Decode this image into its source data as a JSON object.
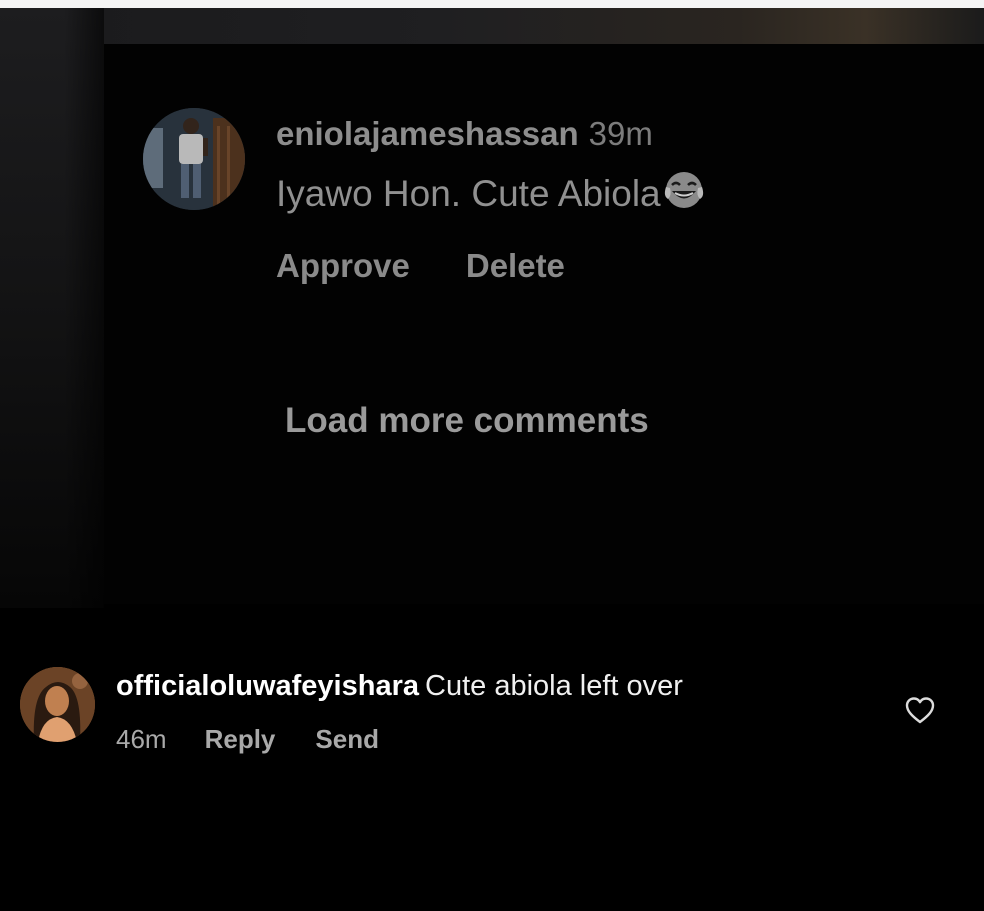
{
  "pending_comment": {
    "username": "eniolajameshassan",
    "time": "39m",
    "text": "Iyawo Hon. Cute Abiola",
    "emoji": "face-with-tears-of-joy-icon",
    "actions": {
      "approve_label": "Approve",
      "delete_label": "Delete"
    }
  },
  "load_more_label": "Load more comments",
  "comment": {
    "username": "officialoluwafeyishara",
    "text": "Cute abiola left over",
    "time": "46m",
    "reply_label": "Reply",
    "send_label": "Send",
    "like_icon": "heart-outline-icon"
  },
  "colors": {
    "background": "#000000",
    "dim_text": "#8a8a8a",
    "primary_text": "#ffffff",
    "secondary_text": "#a9a9a9"
  }
}
